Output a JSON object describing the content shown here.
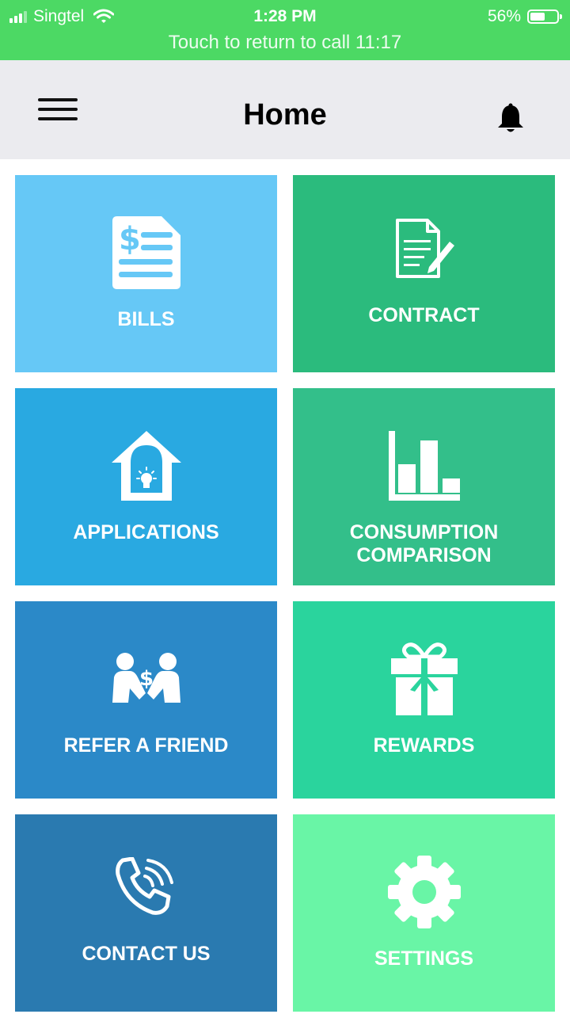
{
  "status_bar": {
    "carrier": "Singtel",
    "time": "1:28 PM",
    "battery": "56%",
    "battery_level": 0.56,
    "call_banner": "Touch to return to call 11:17"
  },
  "header": {
    "title": "Home",
    "menu_icon": "hamburger-menu-icon",
    "notification_icon": "bell-icon"
  },
  "tiles": [
    {
      "label": "BILLS",
      "icon": "bill-icon",
      "color": "#66c8f6"
    },
    {
      "label": "CONTRACT",
      "icon": "contract-icon",
      "color": "#2bbb7d"
    },
    {
      "label": "APPLICATIONS",
      "icon": "house-lightbulb-icon",
      "color": "#29a9e1"
    },
    {
      "label": "CONSUMPTION COMPARISON",
      "icon": "bar-chart-icon",
      "color": "#33bf8a"
    },
    {
      "label": "REFER A FRIEND",
      "icon": "refer-friend-icon",
      "color": "#2b89c8"
    },
    {
      "label": "REWARDS",
      "icon": "gift-icon",
      "color": "#2ad49d"
    },
    {
      "label": "CONTACT US",
      "icon": "phone-icon",
      "color": "#2a7ab0"
    },
    {
      "label": "SETTINGS",
      "icon": "gear-icon",
      "color": "#69f5a6"
    }
  ]
}
